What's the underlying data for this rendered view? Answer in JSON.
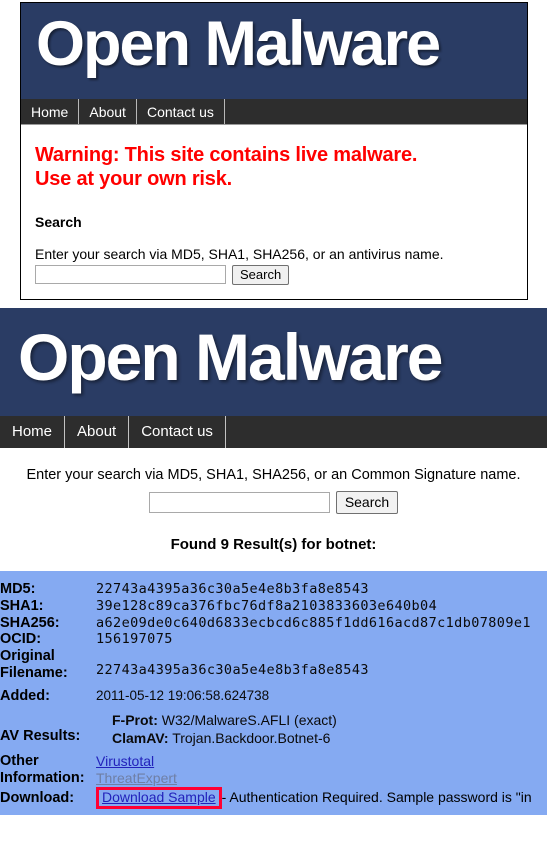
{
  "site": {
    "brand": "Open Malware",
    "nav": [
      "Home",
      "About",
      "Contact us"
    ]
  },
  "preview": {
    "warning_line1": "Warning: This site contains live malware.",
    "warning_line2": "Use at your own risk.",
    "search_heading": "Search",
    "search_hint": "Enter your search via MD5, SHA1, SHA256, or an antivirus name.",
    "search_value": "",
    "search_placeholder": "",
    "search_button": "Search"
  },
  "page": {
    "search_hint": "Enter your search via MD5, SHA1, SHA256, or an Common Signature name.",
    "search_value": "",
    "search_placeholder": "",
    "search_button": "Search",
    "found_text": "Found 9 Result(s) for botnet:"
  },
  "result": {
    "labels": {
      "md5": "MD5:",
      "sha1": "SHA1:",
      "sha256": "SHA256:",
      "ocid": "OCID:",
      "original_filename": "Original Filename:",
      "added": "Added:",
      "av_results": "AV Results:",
      "other_information": "Other Information:",
      "download": "Download:"
    },
    "md5": "22743a4395a36c30a5e4e8b3fa8e8543",
    "sha1": "39e128c89ca376fbc76df8a2103833603e640b04",
    "sha256": "a62e09de0c640d6833ecbcd6c885f1dd616acd87c1db07809e1",
    "ocid": "156197075",
    "original_filename": "22743a4395a36c30a5e4e8b3fa8e8543",
    "added": "2011-05-12 19:06:58.624738",
    "av": [
      {
        "engine": "F-Prot:",
        "detection": "W32/MalwareS.AFLI (exact)"
      },
      {
        "engine": "ClamAV:",
        "detection": "Trojan.Backdoor.Botnet-6"
      }
    ],
    "other_links": [
      {
        "text": "Virustotal",
        "state": "unvisited"
      },
      {
        "text": "ThreatExpert",
        "state": "visited"
      }
    ],
    "download_link": "Download Sample",
    "download_note": "- Authentication Required. Sample password is \"in"
  },
  "colors": {
    "banner_navy": "#2a3c64",
    "nav_dark": "#2d2d2d",
    "warning_red": "#ff0000",
    "panel_blue": "#85aaf2",
    "highlight_red": "#ff0033",
    "link_blue": "#2222bb",
    "link_visited": "#6f7fa5"
  }
}
